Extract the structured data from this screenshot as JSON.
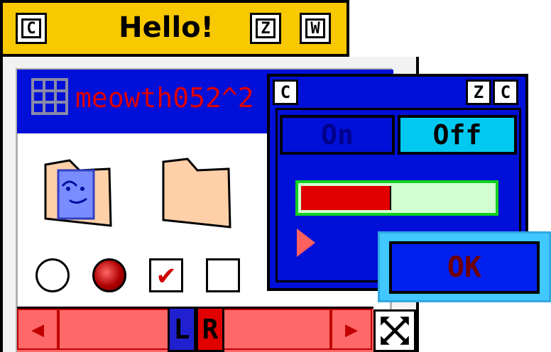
{
  "window_main": {
    "title": "Hello!",
    "close_label": "C",
    "zoom_label": "Z",
    "window_label": "W"
  },
  "window_icons": {
    "title": "meowth052^2",
    "icons": [
      "finder-folder-icon",
      "plain-folder-icon"
    ],
    "controls": {
      "radio_empty": "unselected",
      "radio_selected": "selected",
      "checkbox_checked": "checked",
      "checkbox_unchecked": "unchecked"
    },
    "scrollbar": {
      "left_arrow": "◀",
      "right_arrow": "▶",
      "thumb_left_label": "L",
      "thumb_right_label": "R"
    }
  },
  "window_dialog": {
    "close_label": "C",
    "zoom_label": "Z",
    "extra_label": "C",
    "toggle_on": "On",
    "toggle_off": "Off",
    "progress_percent": 48,
    "ok_label": "OK"
  },
  "colors": {
    "yellow_title": "#f8c800",
    "blue": "#0010d8",
    "red": "#e00000",
    "cyan": "#00c8f0",
    "green": "#10d020"
  }
}
